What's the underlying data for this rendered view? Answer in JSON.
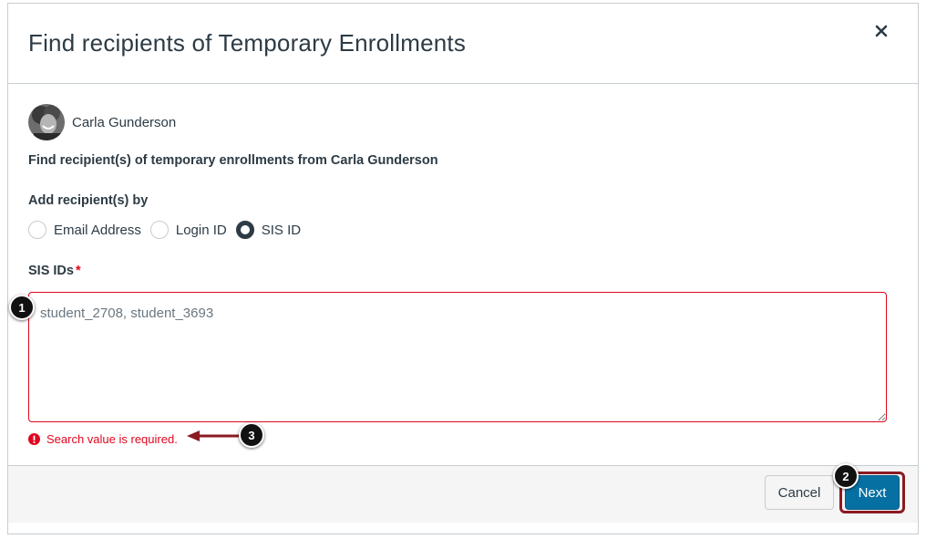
{
  "modal": {
    "title": "Find recipients of Temporary Enrollments",
    "close_icon": "close-icon"
  },
  "user": {
    "name": "Carla Gunderson",
    "avatar_icon": "avatar"
  },
  "instruction": "Find recipient(s) of temporary enrollments from Carla Gunderson",
  "add_by": {
    "label": "Add recipient(s) by",
    "options": [
      {
        "label": "Email Address",
        "checked": false
      },
      {
        "label": "Login ID",
        "checked": false
      },
      {
        "label": "SIS ID",
        "checked": true
      }
    ]
  },
  "ids_field": {
    "label": "SIS IDs",
    "required_marker": "*",
    "placeholder": "student_2708, student_3693",
    "value": ""
  },
  "error": {
    "icon": "warning-icon",
    "text": "Search value is required."
  },
  "footer": {
    "cancel_label": "Cancel",
    "next_label": "Next"
  },
  "callouts": [
    "1",
    "2",
    "3"
  ],
  "colors": {
    "error": "#e0061f",
    "primary_button": "#0770a3",
    "highlight": "#8b1a22",
    "text": "#2d3b45"
  }
}
